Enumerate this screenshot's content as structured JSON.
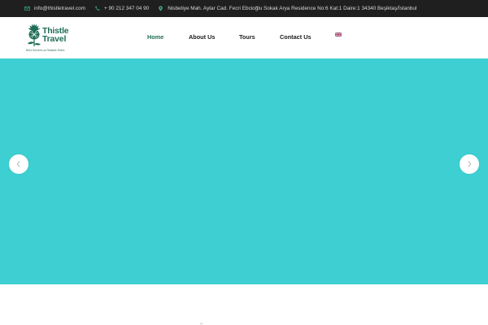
{
  "topbar": {
    "email": "info@thistletravel.com",
    "phone": "+ 90 212 347 04 90",
    "address": "Nisbetiye Mah. Aytar Cad. Fecri Ebcioğlu Sokak Arya Residence No:6 Kat:1 Daire:1 34340 Beşiktaş/İstanbul",
    "icons": [
      "envelope-icon",
      "phone-icon",
      "map-pin-icon"
    ]
  },
  "logo": {
    "line1": "Thistle",
    "line2": "Travel",
    "tagline": "Best Services at Reliable Rates"
  },
  "nav": {
    "items": [
      {
        "label": "Home",
        "active": true
      },
      {
        "label": "About Us",
        "active": false
      },
      {
        "label": "Tours",
        "active": false
      },
      {
        "label": "Contact Us",
        "active": false
      }
    ],
    "language": "English flag"
  },
  "hero": {
    "background_color": "#3ecfd2",
    "prev_icon": "chevron-left-icon",
    "next_icon": "chevron-right-icon"
  },
  "colors": {
    "brand": "#1f6d57",
    "topbar_bg": "#1f1f1f",
    "icon_green": "#3fa783"
  }
}
